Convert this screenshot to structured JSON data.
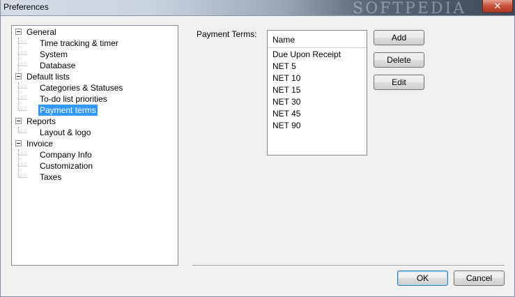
{
  "window": {
    "title": "Preferences",
    "watermark": "SOFTPEDIA",
    "close_glyph": "✕"
  },
  "tree": {
    "general": {
      "label": "General",
      "children": [
        "Time tracking & timer",
        "System",
        "Database"
      ]
    },
    "default_lists": {
      "label": "Default lists",
      "children": [
        "Categories & Statuses",
        "To-do list priorities",
        "Payment terms"
      ]
    },
    "reports": {
      "label": "Reports",
      "children": [
        "Layout & logo"
      ]
    },
    "invoice": {
      "label": "Invoice",
      "children": [
        "Company Info",
        "Customization",
        "Taxes"
      ]
    },
    "selected": "Payment terms"
  },
  "payment_terms": {
    "label": "Payment Terms:",
    "column_header": "Name",
    "items": [
      "Due Upon Receipt",
      "NET 5",
      "NET 10",
      "NET 15",
      "NET 30",
      "NET 45",
      "NET 90"
    ]
  },
  "buttons": {
    "add": "Add",
    "delete": "Delete",
    "edit": "Edit",
    "ok": "OK",
    "cancel": "Cancel"
  },
  "colors": {
    "selection": "#3399ff",
    "close_button": "#c9523c"
  }
}
